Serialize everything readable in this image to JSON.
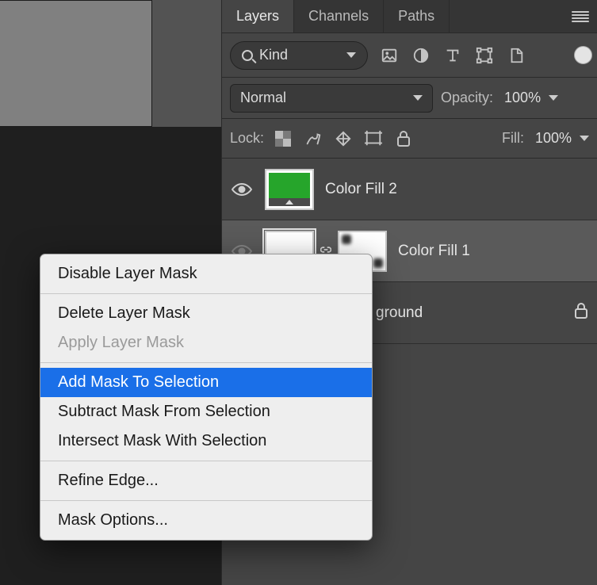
{
  "tabs": {
    "layers": "Layers",
    "channels": "Channels",
    "paths": "Paths"
  },
  "filter": {
    "kind": "Kind"
  },
  "blend": {
    "mode": "Normal",
    "opacity_label": "Opacity:",
    "opacity_value": "100%"
  },
  "lock": {
    "label": "Lock:",
    "fill_label": "Fill:",
    "fill_value": "100%"
  },
  "layers_list": {
    "l0": "Color Fill 2",
    "l1": "Color Fill 1",
    "l2": "ground"
  },
  "ctx": {
    "disable": "Disable Layer Mask",
    "delete": "Delete Layer Mask",
    "apply": "Apply Layer Mask",
    "add": "Add Mask To Selection",
    "subtract": "Subtract Mask From Selection",
    "intersect": "Intersect Mask With Selection",
    "refine": "Refine Edge...",
    "options": "Mask Options..."
  }
}
